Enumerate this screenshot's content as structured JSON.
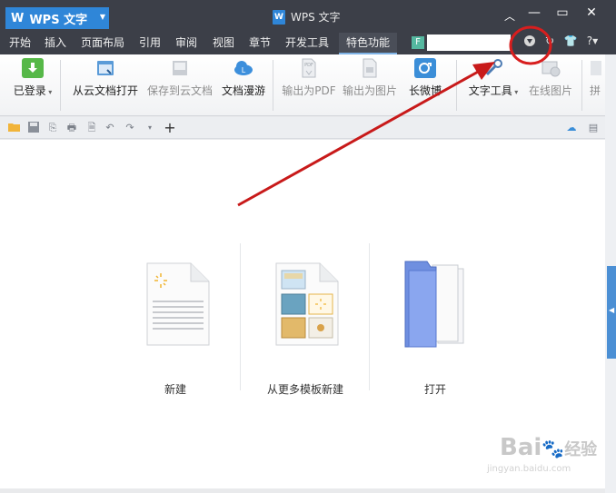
{
  "app": {
    "logo_letter": "W",
    "name": "WPS 文字"
  },
  "window": {
    "title": "WPS 文字",
    "doc_icon_letter": "W"
  },
  "menu": {
    "tabs": [
      {
        "label": "开始"
      },
      {
        "label": "插入"
      },
      {
        "label": "页面布局"
      },
      {
        "label": "引用"
      },
      {
        "label": "审阅"
      },
      {
        "label": "视图"
      },
      {
        "label": "章节"
      },
      {
        "label": "开发工具"
      },
      {
        "label": "特色功能",
        "active": true
      }
    ],
    "help_label": "?"
  },
  "ribbon": {
    "buttons": [
      {
        "label": "已登录",
        "icon": "download-arrow-icon",
        "enabled": true
      },
      {
        "label": "从云文档打开",
        "icon": "cloud-open-icon",
        "enabled": true
      },
      {
        "label": "保存到云文档",
        "icon": "cloud-save-icon",
        "enabled": false
      },
      {
        "label": "文档漫游",
        "icon": "cloud-roam-icon",
        "enabled": true
      },
      {
        "label": "输出为PDF",
        "icon": "pdf-export-icon",
        "enabled": false
      },
      {
        "label": "输出为图片",
        "icon": "image-export-icon",
        "enabled": false
      },
      {
        "label": "长微博",
        "icon": "weibo-icon",
        "enabled": true
      },
      {
        "label": "文字工具",
        "icon": "text-tools-icon",
        "enabled": true
      },
      {
        "label": "在线图片",
        "icon": "online-image-icon",
        "enabled": false
      },
      {
        "label": "拼",
        "icon": "more-icon",
        "enabled": false
      }
    ]
  },
  "start_page": {
    "items": [
      {
        "label": "新建",
        "icon": "new-document-icon"
      },
      {
        "label": "从更多模板新建",
        "icon": "template-document-icon"
      },
      {
        "label": "打开",
        "icon": "open-folder-icon"
      }
    ]
  },
  "watermark": {
    "brand": "Bai",
    "brand2": "经验",
    "url": "jingyan.baidu.com"
  },
  "colors": {
    "titlebar": "#3c3f48",
    "accent": "#2f86d8",
    "annotation": "#d81e1e"
  }
}
